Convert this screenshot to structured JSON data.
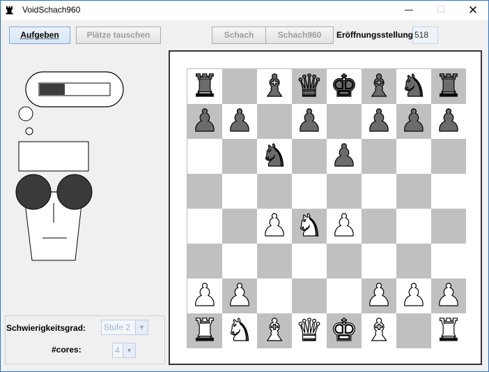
{
  "window": {
    "title": "VoidSchach960",
    "icons": {
      "app": "chess-rook-icon",
      "minimize": "minimize-icon",
      "maximize": "maximize-icon",
      "close": "close-icon"
    }
  },
  "toolbar": {
    "resign_label": "Aufgeben",
    "swap_label": "Plätze tauschen",
    "chess_label": "Schach",
    "chess960_label": "Schach960",
    "opening_label": "Eröffnungsstellung:",
    "opening_value": "518"
  },
  "thinking": {
    "progress": 0.36
  },
  "settings": {
    "difficulty_label": "Schwierigkeitsgrad:",
    "difficulty_value": "Stufe 2",
    "cores_label": "#cores:",
    "cores_value": "4"
  },
  "board": {
    "light_color": "#ffffff",
    "dark_color": "#c0c0c0",
    "ranks": [
      [
        "bR",
        "",
        "bB",
        "bQ",
        "bK",
        "bB",
        "bN",
        "bR"
      ],
      [
        "bP",
        "bP",
        "",
        "bP",
        "",
        "bP",
        "bP",
        "bP"
      ],
      [
        "",
        "",
        "bN",
        "",
        "bP",
        "",
        "",
        ""
      ],
      [
        "",
        "",
        "",
        "",
        "",
        "",
        "",
        ""
      ],
      [
        "",
        "",
        "wP",
        "wN",
        "wP",
        "",
        "",
        ""
      ],
      [
        "",
        "",
        "",
        "",
        "",
        "",
        "",
        ""
      ],
      [
        "wP",
        "wP",
        "",
        "",
        "",
        "wP",
        "wP",
        "wP"
      ],
      [
        "wR",
        "wN",
        "wB",
        "wQ",
        "wK",
        "wB",
        "",
        "wR"
      ]
    ]
  }
}
